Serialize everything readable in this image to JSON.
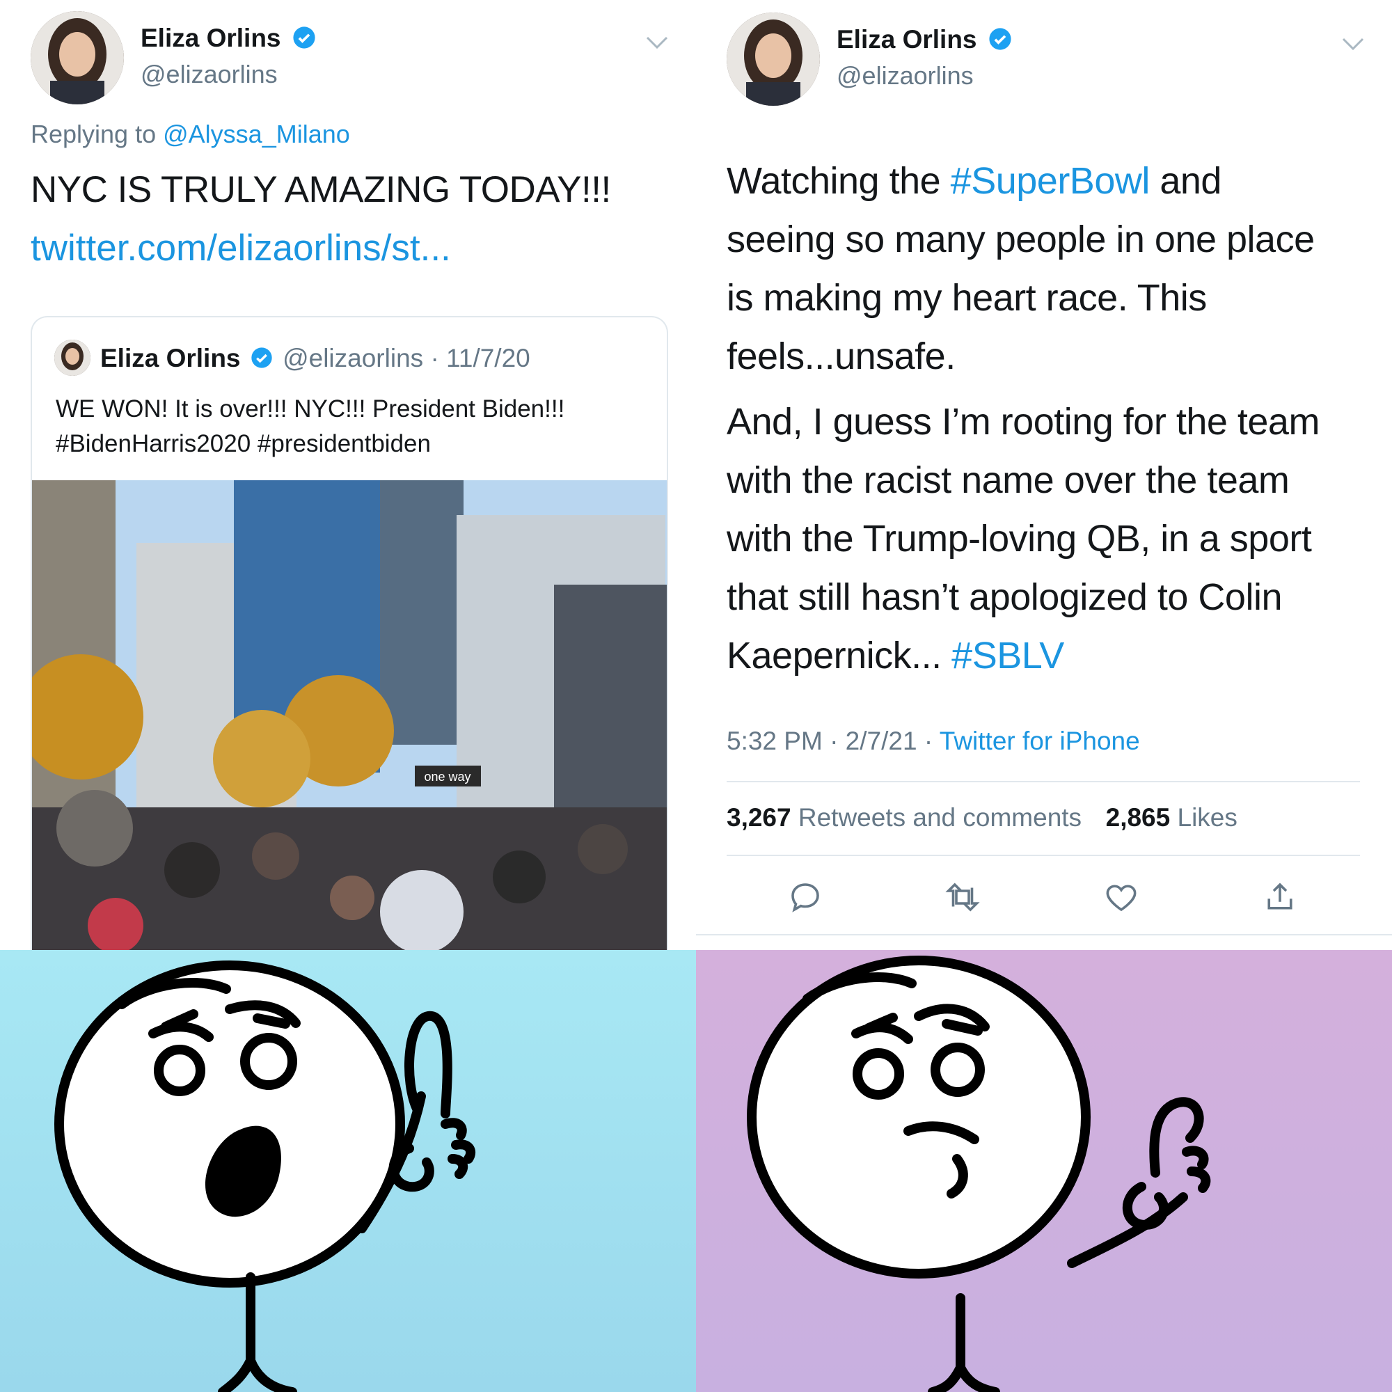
{
  "colors": {
    "link": "#1b95e0",
    "muted": "#657786",
    "text": "#14171a",
    "verified": "#1da1f2",
    "meme_left_bg": "#a6e6f2",
    "meme_right_bg": "#d0b0da"
  },
  "left_tweet": {
    "author_name": "Eliza Orlins",
    "author_handle": "@elizaorlins",
    "replying_prefix": "Replying to",
    "replying_to": "@Alyssa_Milano",
    "text": "NYC IS TRULY AMAZING TODAY!!!",
    "link": "twitter.com/elizaorlins/st...",
    "quoted": {
      "author_name": "Eliza Orlins",
      "author_handle": "@elizaorlins",
      "date": "· 11/7/20",
      "line1": "WE WON! It is over!!! NYC!!! President Biden!!!",
      "line2": "#BidenHarris2020 #presidentbiden",
      "image_label": "one way"
    }
  },
  "right_tweet": {
    "author_name": "Eliza Orlins",
    "author_handle": "@elizaorlins",
    "p1": {
      "before": "Watching the ",
      "hashtag": "#SuperBowl",
      "after_line1": " and",
      "line2": "seeing so many people in one place",
      "line3": "is making my heart race. This",
      "line4": "feels...unsafe."
    },
    "p2": {
      "line1": "And, I guess I’m rooting for the team",
      "line2": "with the racist name over the team",
      "line3": "with the Trump-loving QB, in a sport",
      "line4": "that still hasn’t apologized to Colin",
      "line5_before": "Kaepernick... ",
      "line5_hashtag": "#SBLV"
    },
    "time": "5:32 PM · 2/7/21 ·",
    "source": "Twitter for iPhone",
    "retweets_count": "3,267",
    "retweets_label": "Retweets and comments",
    "likes_count": "2,865",
    "likes_label": "Likes",
    "actions": [
      "reply-icon",
      "retweet-icon",
      "like-icon",
      "share-icon"
    ]
  },
  "meme": {
    "left": "stick figure pointing up, excited",
    "right": "stick figure pointing up, hesitant"
  }
}
